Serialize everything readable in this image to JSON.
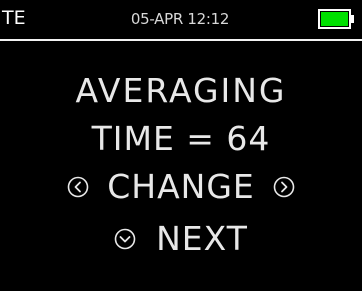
{
  "status_bar": {
    "mode": "TE",
    "datetime": "05-APR 12:12",
    "battery_icon": "battery-full-icon",
    "battery_color": "#00e000"
  },
  "screen": {
    "title_line1": "AVERAGING",
    "title_line2": "TIME = 64",
    "change_label": "CHANGE",
    "change_left_icon": "chevron-left-circle-icon",
    "change_right_icon": "chevron-right-circle-icon",
    "next_label": "NEXT",
    "next_icon": "chevron-down-circle-icon"
  }
}
